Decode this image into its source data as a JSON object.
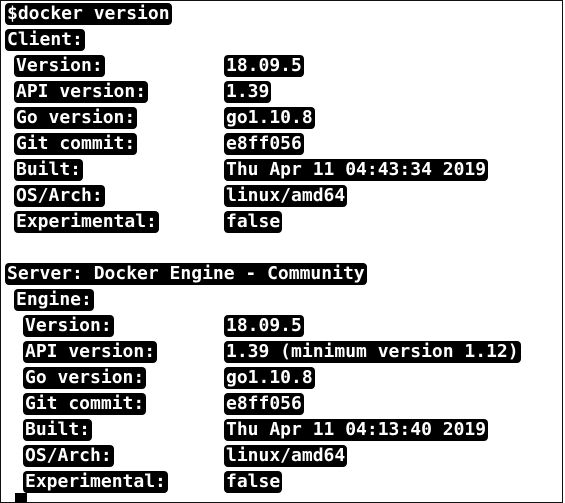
{
  "terminal": {
    "command": "$docker version",
    "client": {
      "heading": "Client:",
      "rows": [
        {
          "key": "Version:",
          "value": "18.09.5"
        },
        {
          "key": "API version:",
          "value": "1.39"
        },
        {
          "key": "Go version:",
          "value": "go1.10.8"
        },
        {
          "key": "Git commit:",
          "value": "e8ff056"
        },
        {
          "key": "Built:",
          "value": "Thu Apr 11 04:43:34 2019"
        },
        {
          "key": "OS/Arch:",
          "value": "linux/amd64"
        },
        {
          "key": "Experimental:",
          "value": "false"
        }
      ]
    },
    "server": {
      "heading": "Server: Docker Engine - Community",
      "engine_heading": "Engine:",
      "rows": [
        {
          "key": "Version:",
          "value": "18.09.5"
        },
        {
          "key": "API version:",
          "value": "1.39 (minimum version 1.12)"
        },
        {
          "key": "Go version:",
          "value": "go1.10.8"
        },
        {
          "key": "Git commit:",
          "value": "e8ff056"
        },
        {
          "key": "Built:",
          "value": "Thu Apr 11 04:13:40 2019"
        },
        {
          "key": "OS/Arch:",
          "value": "linux/amd64"
        },
        {
          "key": "Experimental:",
          "value": "false"
        }
      ]
    }
  }
}
